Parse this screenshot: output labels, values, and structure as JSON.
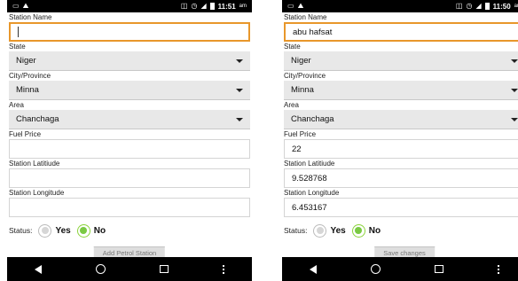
{
  "screens": [
    {
      "statusbar": {
        "time": "11:51",
        "ampm": "am"
      },
      "form": {
        "station_name_label": "Station Name",
        "station_name_value": "",
        "state_label": "State",
        "state_value": "Niger",
        "city_label": "City/Province",
        "city_value": "Minna",
        "area_label": "Area",
        "area_value": "Chanchaga",
        "fuel_price_label": "Fuel Price",
        "fuel_price_value": "",
        "latitude_label": "Station Latitiude",
        "latitude_value": "",
        "longitude_label": "Station Longitude",
        "longitude_value": "",
        "status_label": "Status:",
        "status_yes": "Yes",
        "status_no": "No",
        "status_selected": "No"
      },
      "action_button": "Add Petrol Station"
    },
    {
      "statusbar": {
        "time": "11:50",
        "ampm": "am"
      },
      "form": {
        "station_name_label": "Station Name",
        "station_name_value": "abu hafsat",
        "state_label": "State",
        "state_value": "Niger",
        "city_label": "City/Province",
        "city_value": "Minna",
        "area_label": "Area",
        "area_value": "Chanchaga",
        "fuel_price_label": "Fuel Price",
        "fuel_price_value": "22",
        "latitude_label": "Station Latitiude",
        "latitude_value": "9.528768",
        "longitude_label": "Station Longitude",
        "longitude_value": "6.453167",
        "status_label": "Status:",
        "status_yes": "Yes",
        "status_no": "No",
        "status_selected": "No"
      },
      "action_button": "Save changes"
    }
  ],
  "icons": {
    "statusbar_left": [
      "notification-icon",
      "image-icon"
    ],
    "statusbar_right": [
      "vibrate-icon",
      "alarm-icon",
      "signal-icon",
      "battery-icon"
    ],
    "navbar": [
      "back-icon",
      "home-icon",
      "recent-apps-icon",
      "overflow-menu-icon"
    ]
  }
}
